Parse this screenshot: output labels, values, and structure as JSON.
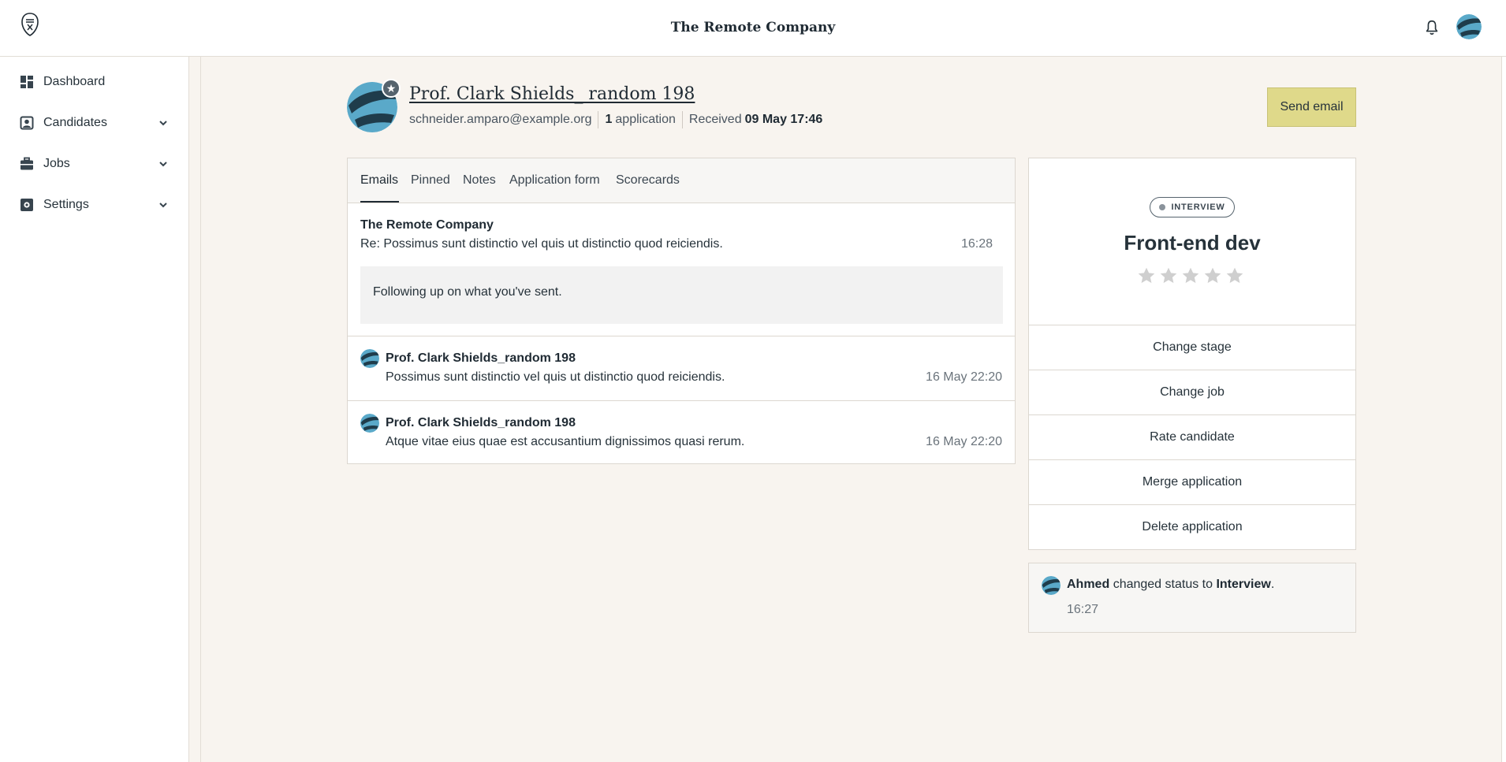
{
  "header": {
    "company_name": "The Remote Company"
  },
  "sidebar": {
    "items": [
      {
        "label": "Dashboard",
        "icon": "dashboard-icon",
        "expandable": false
      },
      {
        "label": "Candidates",
        "icon": "candidates-icon",
        "expandable": true
      },
      {
        "label": "Jobs",
        "icon": "jobs-icon",
        "expandable": true
      },
      {
        "label": "Settings",
        "icon": "settings-icon",
        "expandable": true
      }
    ]
  },
  "candidate": {
    "name": "Prof. Clark Shields_ random 198",
    "email": "schneider.amparo@example.org",
    "application_count": "1",
    "application_label": "application",
    "received_label": "Received",
    "received_date": "09 May 17:46",
    "send_email_label": "Send email"
  },
  "tabs": [
    {
      "label": "Emails",
      "active": true
    },
    {
      "label": "Pinned",
      "active": false
    },
    {
      "label": "Notes",
      "active": false
    },
    {
      "label": "Application form",
      "active": false
    },
    {
      "label": "Scorecards",
      "active": false
    }
  ],
  "emails": {
    "first": {
      "sender": "The Remote Company",
      "subject": "Re: Possimus sunt distinctio vel quis ut distinctio quod reiciendis.",
      "time": "16:28",
      "body": "Following up on what you've sent."
    },
    "rows": [
      {
        "sender": "Prof. Clark Shields_random 198",
        "subject": "Possimus sunt distinctio vel quis ut distinctio quod reiciendis.",
        "time": "16 May 22:20"
      },
      {
        "sender": "Prof. Clark Shields_random 198",
        "subject": "Atque vitae eius quae est accusantium dignissimos quasi rerum.",
        "time": "16 May 22:20"
      }
    ]
  },
  "application": {
    "stage": "INTERVIEW",
    "job_title": "Front-end dev",
    "rating": 0,
    "rating_max": 5,
    "actions": [
      "Change stage",
      "Change job",
      "Rate candidate",
      "Merge application",
      "Delete application"
    ]
  },
  "activity": {
    "actor": "Ahmed",
    "text": "changed status to",
    "status": "Interview",
    "end": ".",
    "time": "16:27"
  },
  "colors": {
    "background": "#f8f4ef",
    "accent_button": "#dfd98a",
    "text_primary": "#1f2a33",
    "avatar_light": "#5aa9c9",
    "avatar_dark": "#1f3c4b"
  }
}
